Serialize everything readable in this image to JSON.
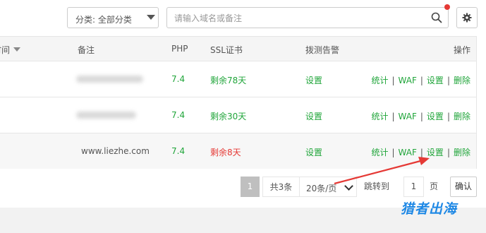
{
  "toolbar": {
    "category_label": "分类: 全部分类",
    "search_placeholder": "请输入域名或备注"
  },
  "table": {
    "headers": {
      "time": "时间",
      "remark": "备注",
      "php": "PHP",
      "ssl": "SSL证书",
      "monitor": "拨测告警",
      "actions": "操作"
    },
    "rows": [
      {
        "remark": "",
        "php": "7.4",
        "ssl": "剩余78天",
        "ssl_status": "ok",
        "monitor": "设置"
      },
      {
        "remark": "",
        "php": "7.4",
        "ssl": "剩余30天",
        "ssl_status": "ok",
        "monitor": "设置"
      },
      {
        "remark": "www.liezhe.com",
        "php": "7.4",
        "ssl": "剩余8天",
        "ssl_status": "warning",
        "monitor": "设置"
      }
    ],
    "row_actions": [
      "统计",
      "WAF",
      "设置",
      "删除"
    ],
    "action_separator": "|"
  },
  "pagination": {
    "current_page": "1",
    "total": "共3条",
    "page_size": "20条/页",
    "jump_label": "跳转到",
    "jump_value": "1",
    "page_unit": "页",
    "confirm": "确认"
  },
  "watermark": "猎者出海",
  "colors": {
    "link_green": "#20a53a",
    "warning_red": "#e53935",
    "annotation_arrow": "#e53935",
    "watermark_blue": "#1e88e5"
  },
  "icons": [
    "search-icon",
    "gear-icon",
    "sort-caret-icon",
    "chevron-down-icon"
  ]
}
